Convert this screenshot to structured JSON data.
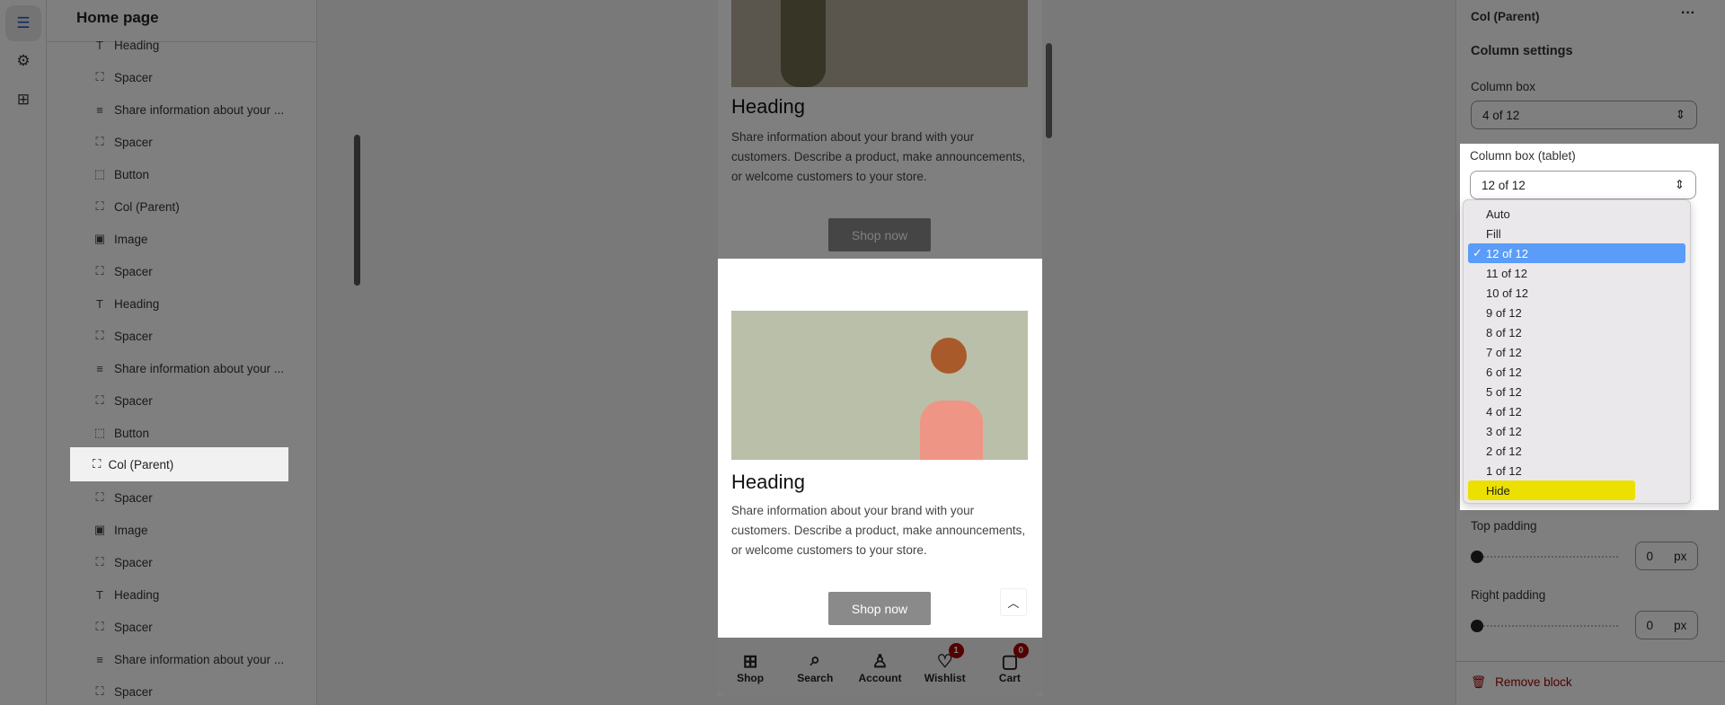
{
  "sidebar": {
    "title": "Home page",
    "items": [
      {
        "icon": "T",
        "label": "Heading"
      },
      {
        "icon": "⛶",
        "label": "Spacer"
      },
      {
        "icon": "≡",
        "label": "Share information about your ..."
      },
      {
        "icon": "⛶",
        "label": "Spacer"
      },
      {
        "icon": "⬚",
        "label": "Button"
      },
      {
        "icon": "⛶",
        "label": "Col (Parent)"
      },
      {
        "icon": "▣",
        "label": "Image"
      },
      {
        "icon": "⛶",
        "label": "Spacer"
      },
      {
        "icon": "T",
        "label": "Heading"
      },
      {
        "icon": "⛶",
        "label": "Spacer"
      },
      {
        "icon": "≡",
        "label": "Share information about your ..."
      },
      {
        "icon": "⛶",
        "label": "Spacer"
      },
      {
        "icon": "⬚",
        "label": "Button"
      },
      {
        "icon": "⛶",
        "label": "Col (Parent)"
      },
      {
        "icon": "⛶",
        "label": "Spacer"
      },
      {
        "icon": "▣",
        "label": "Image"
      },
      {
        "icon": "⛶",
        "label": "Spacer"
      },
      {
        "icon": "T",
        "label": "Heading"
      },
      {
        "icon": "⛶",
        "label": "Spacer"
      },
      {
        "icon": "≡",
        "label": "Share information about your ..."
      },
      {
        "icon": "⛶",
        "label": "Spacer"
      }
    ],
    "selected_index": 13
  },
  "preview": {
    "sections": [
      {
        "heading": "Heading",
        "text": "Share information about your brand with your customers. Describe a product, make announcements, or welcome customers to your store.",
        "button": "Shop now"
      },
      {
        "heading": "Heading",
        "text": "Share information about your brand with your customers. Describe a product, make announcements, or welcome customers to your store.",
        "button": "Shop now"
      }
    ],
    "nav": [
      {
        "icon": "grid",
        "label": "Shop"
      },
      {
        "icon": "search",
        "label": "Search"
      },
      {
        "icon": "user",
        "label": "Account"
      },
      {
        "icon": "heart",
        "label": "Wishlist",
        "badge": "1"
      },
      {
        "icon": "bag",
        "label": "Cart",
        "badge": "0"
      }
    ]
  },
  "panel": {
    "title": "Col (Parent)",
    "section": "Column settings",
    "column_box_label": "Column box",
    "column_box_value": "4 of 12",
    "tablet_label": "Column box (tablet)",
    "tablet_value": "12 of 12",
    "options": [
      "Auto",
      "Fill",
      "12 of 12",
      "11 of 12",
      "10 of 12",
      "9 of 12",
      "8 of 12",
      "7 of 12",
      "6 of 12",
      "5 of 12",
      "4 of 12",
      "3 of 12",
      "2 of 12",
      "1 of 12",
      "Hide"
    ],
    "selected_option": "12 of 12",
    "highlighted_option": "Hide",
    "top_padding_label": "Top padding",
    "top_padding": "0",
    "right_padding_label": "Right padding",
    "right_padding": "0",
    "unit": "px",
    "remove": "Remove block"
  },
  "colors": {
    "accent": "#5a9cf8",
    "highlight": "#ece000",
    "danger": "#a00000"
  }
}
